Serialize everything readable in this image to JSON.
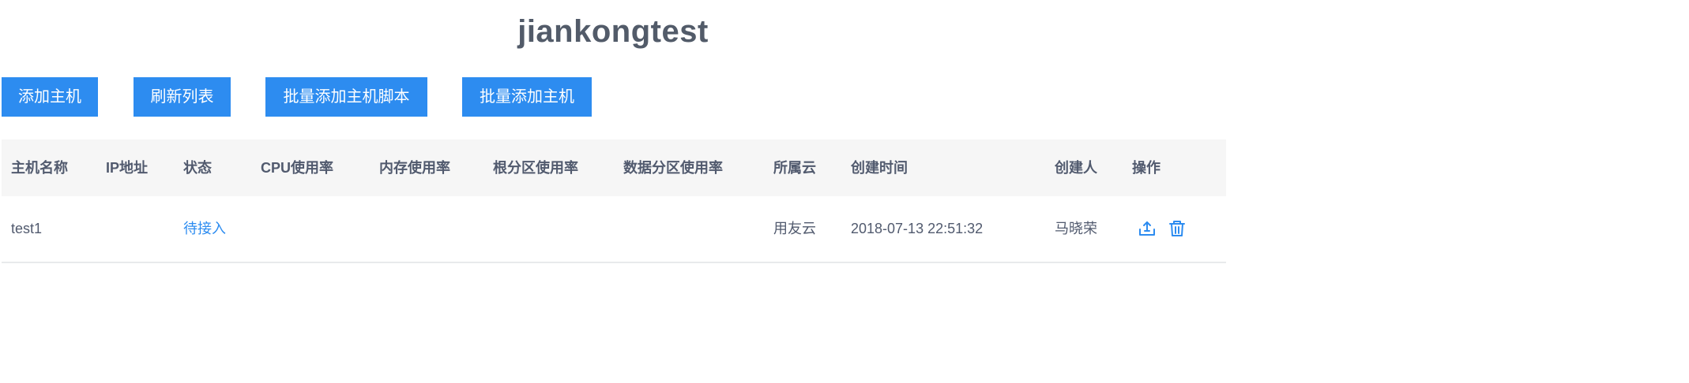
{
  "page": {
    "title": "jiankongtest"
  },
  "toolbar": {
    "add_host": "添加主机",
    "refresh_list": "刷新列表",
    "batch_add_script": "批量添加主机脚本",
    "batch_add_host": "批量添加主机"
  },
  "table": {
    "columns": {
      "host_name": "主机名称",
      "ip": "IP地址",
      "status": "状态",
      "cpu": "CPU使用率",
      "memory": "内存使用率",
      "root_partition": "根分区使用率",
      "data_partition": "数据分区使用率",
      "cloud": "所属云",
      "created_at": "创建时间",
      "creator": "创建人",
      "actions": "操作"
    },
    "rows": [
      {
        "host_name": "test1",
        "ip": "",
        "status": "待接入",
        "cpu": "",
        "memory": "",
        "root_partition": "",
        "data_partition": "",
        "cloud": "用友云",
        "created_at": "2018-07-13 22:51:32",
        "creator": "马晓荣",
        "actions": [
          "edit-icon",
          "delete-icon"
        ]
      }
    ]
  },
  "colors": {
    "primary": "#2d8cf0",
    "header_bg": "#f6f6f6",
    "text": "#515a6e",
    "title": "#525b69"
  }
}
